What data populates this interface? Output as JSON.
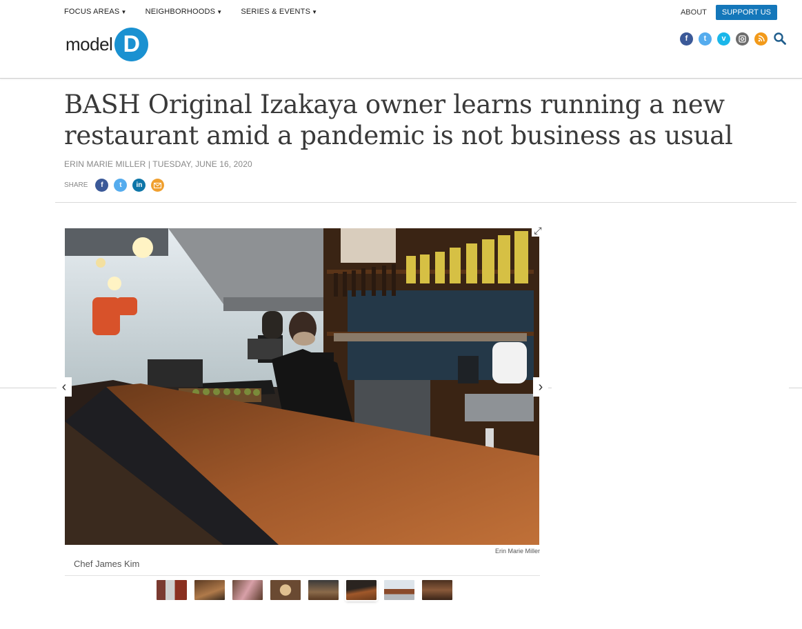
{
  "nav": {
    "items": [
      {
        "label": "FOCUS AREAS"
      },
      {
        "label": "NEIGHBORHOODS"
      },
      {
        "label": "SERIES & EVENTS"
      }
    ],
    "about": "ABOUT",
    "support": "SUPPORT US"
  },
  "logo": {
    "text": "model",
    "letter": "D"
  },
  "social_icons": [
    "facebook-icon",
    "twitter-icon",
    "vimeo-icon",
    "instagram-icon",
    "rss-icon",
    "search-icon"
  ],
  "article": {
    "title": "BASH Original Izakaya owner learns running a new restaurant amid a pandemic is not business as usual",
    "byline": "ERIN MARIE MILLER | TUESDAY, JUNE 16, 2020",
    "share_label": "SHARE"
  },
  "share_icons": [
    "facebook-icon",
    "twitter-icon",
    "linkedin-icon",
    "email-icon"
  ],
  "gallery": {
    "credit": "Erin Marie Miller",
    "caption": "Chef James Kim",
    "thumb_count": 8,
    "active_index": 5
  },
  "colors": {
    "accent": "#1477ba",
    "logo_blue": "#1a91d1",
    "facebook": "#3b5998",
    "twitter": "#55acee",
    "linkedin": "#0e76a8",
    "email": "#f0a030",
    "vimeo": "#1ab7ea",
    "instagram": "#6d6d6d",
    "rss": "#f29a1a"
  }
}
